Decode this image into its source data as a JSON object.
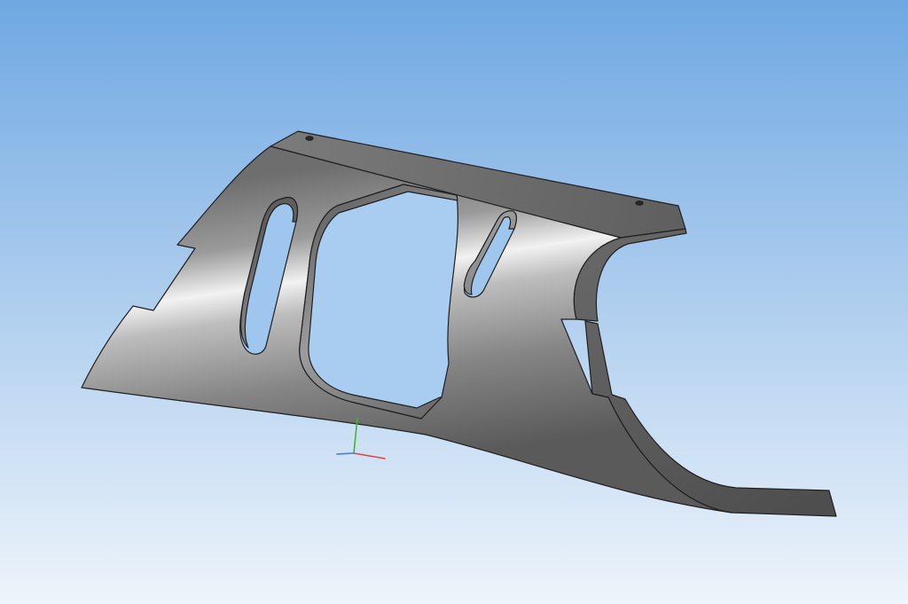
{
  "viewport": {
    "background_top_color": "#6fa8e2",
    "background_bottom_color": "#eef4fb"
  },
  "part": {
    "shape": "bracket",
    "body_color": "#7c7c7c",
    "highlight_color": "#f2f2f2",
    "edge_color": "#1f1f1f",
    "features": [
      "oblong-slot-left",
      "large-cutout-center",
      "oblong-slot-right",
      "arc-notch-right",
      "mounting-holes"
    ]
  },
  "triad": {
    "axes": [
      {
        "axis": "x",
        "color": "#e0473a"
      },
      {
        "axis": "y",
        "color": "#43b52e"
      },
      {
        "axis": "z",
        "color": "#3a7fe0"
      }
    ]
  }
}
